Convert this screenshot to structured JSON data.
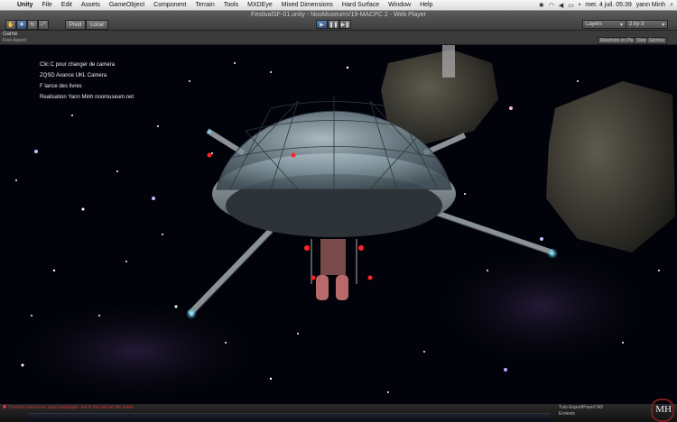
{
  "menubar": {
    "app": "Unity",
    "items": [
      "File",
      "Edit",
      "Assets",
      "GameObject",
      "Component",
      "Terrain",
      "Tools",
      "MXDEye",
      "Mixed Dimensions",
      "Hard Surface",
      "Window",
      "Help"
    ],
    "datetime": "mer. 4 juil. 05:39",
    "user": "yann Minh"
  },
  "toolbar": {
    "window_title": "FestivalSF-01.unity - NooMuseumV19-MACPC 2 - Web Player",
    "pivot": "Pivot",
    "local": "Local",
    "layers": "Layers",
    "layout": "2 by 3"
  },
  "game": {
    "tab": "Game",
    "aspect": "Free Aspect",
    "maximize": "Maximize on Play",
    "stats": "Stats",
    "gizmos": "Gizmos"
  },
  "hud": [
    "Clic C pour changer de camera",
    "ZQSD Avance UKL Camera",
    "F lance des livres",
    "Realisation Yann Minh  noomuseum.net"
  ],
  "status": {
    "error": "Tracked resources: input packages: not in the list but the asset",
    "files": [
      "Tuto-ExportPoserC4D",
      "Erxtexts"
    ]
  },
  "logo": "MH"
}
